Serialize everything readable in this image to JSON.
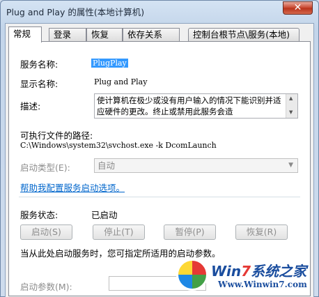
{
  "window": {
    "title": "Plug and Play 的属性(本地计算机)",
    "close_glyph": "✕"
  },
  "tabs": [
    {
      "label": "常规",
      "active": true
    },
    {
      "label": "登录"
    },
    {
      "label": "恢复"
    },
    {
      "label": "依存关系"
    },
    {
      "label": "控制台根节点\\服务(本地)"
    }
  ],
  "general": {
    "service_name_label": "服务名称:",
    "service_name_value": "PlugPlay",
    "display_name_label": "显示名称:",
    "display_name_value": "Plug and Play",
    "description_label": "描述:",
    "description_value": "使计算机在极少或没有用户输入的情况下能识别并适应硬件的更改。终止或禁用此服务会造",
    "path_label": "可执行文件的路径:",
    "path_value": "C:\\Windows\\system32\\svchost.exe -k DcomLaunch",
    "startup_type_label": "启动类型(E):",
    "startup_type_value": "自动",
    "help_link": "帮助我配置服务启动选项。",
    "status_label": "服务状态:",
    "status_value": "已启动",
    "buttons": {
      "start": "启动(S)",
      "stop": "停止(T)",
      "pause": "暂停(P)",
      "resume": "恢复(R)"
    },
    "hint_text": "当从此处启动服务时，您可指定所适用的启动参数。",
    "start_params_label": "启动参数(M):",
    "start_params_value": ""
  },
  "watermark": {
    "brand_prefix": "Win",
    "brand_seven": "7",
    "brand_suffix": "系统之家",
    "url": "Www.Winwin7.com"
  },
  "icons": [
    "close-icon",
    "dropdown-caret-icon",
    "scroll-up-icon",
    "scroll-down-icon",
    "win7-logo-icon"
  ]
}
